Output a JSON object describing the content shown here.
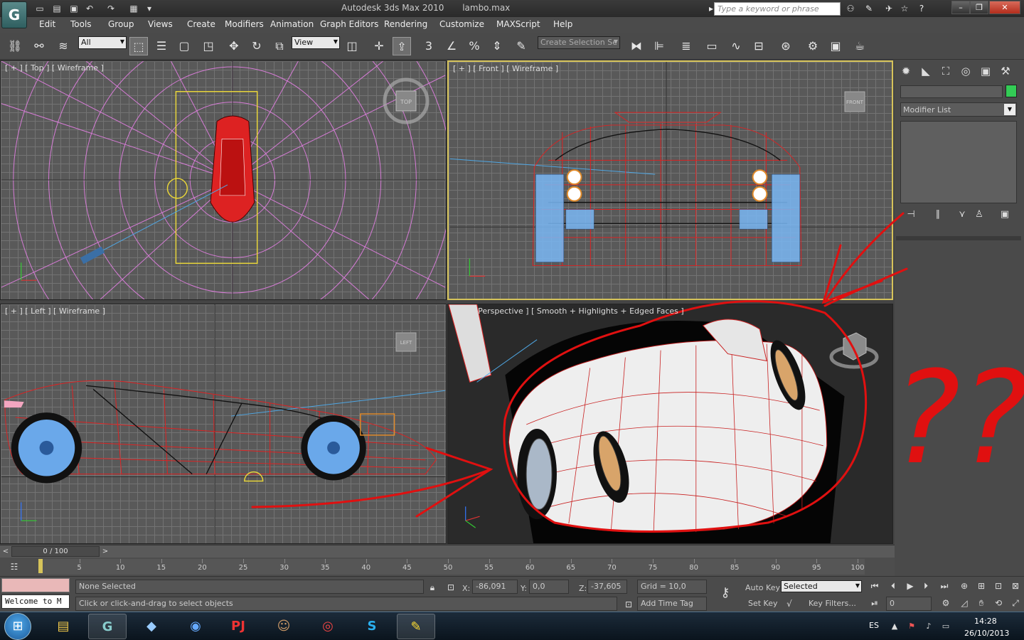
{
  "title": {
    "app_name": "Autodesk 3ds Max  2010",
    "file_name": "lambo.max",
    "search_placeholder": "Type a keyword or phrase"
  },
  "menu": [
    "Edit",
    "Tools",
    "Group",
    "Views",
    "Create",
    "Modifiers",
    "Animation",
    "Graph Editors",
    "Rendering",
    "Customize",
    "MAXScript",
    "Help"
  ],
  "toolbar": {
    "selection_filter": "All",
    "reference_coord": "View",
    "named_selection": "Create Selection Se",
    "snap_3": "3"
  },
  "viewports": {
    "top": {
      "label": "[ + ] [ Top ] [ Wireframe ]",
      "nav_cube": "TOP"
    },
    "front": {
      "label": "[ + ] [ Front ] [ Wireframe ]",
      "nav_cube": "FRONT"
    },
    "left": {
      "label": "[ + ] [ Left ] [ Wireframe ]",
      "nav_cube": "LEFT"
    },
    "perspective": {
      "label": "[ + ] [ Perspective ] [ Smooth + Highlights + Edged Faces ]"
    }
  },
  "command_panel": {
    "modifier_list": "Modifier List",
    "color_swatch": "#33cc55"
  },
  "timeline": {
    "frame_display": "0 / 100",
    "ticks": [
      "5",
      "10",
      "15",
      "20",
      "25",
      "30",
      "35",
      "40",
      "45",
      "50",
      "55",
      "60",
      "65",
      "70",
      "75",
      "80",
      "85",
      "90",
      "95",
      "100"
    ]
  },
  "status": {
    "listener": "Welcome to M",
    "selection": "None Selected",
    "prompt": "Click or click-and-drag to select objects",
    "x_label": "X:",
    "x_value": "-86,091",
    "y_label": "Y:",
    "y_value": "0,0",
    "z_label": "Z:",
    "z_value": "-37,605",
    "grid": "Grid = 10,0",
    "add_time_tag": "Add Time Tag",
    "auto_key": "Auto Key",
    "set_key": "Set Key",
    "key_mode": "Selected",
    "key_filters": "Key Filters...",
    "current_frame": "0"
  },
  "annotation": {
    "question_marks": "??",
    "color": "#e01010"
  },
  "taskbar": {
    "language": "ES",
    "time": "14:28",
    "date": "26/10/2013",
    "pj_label": "PJ"
  }
}
